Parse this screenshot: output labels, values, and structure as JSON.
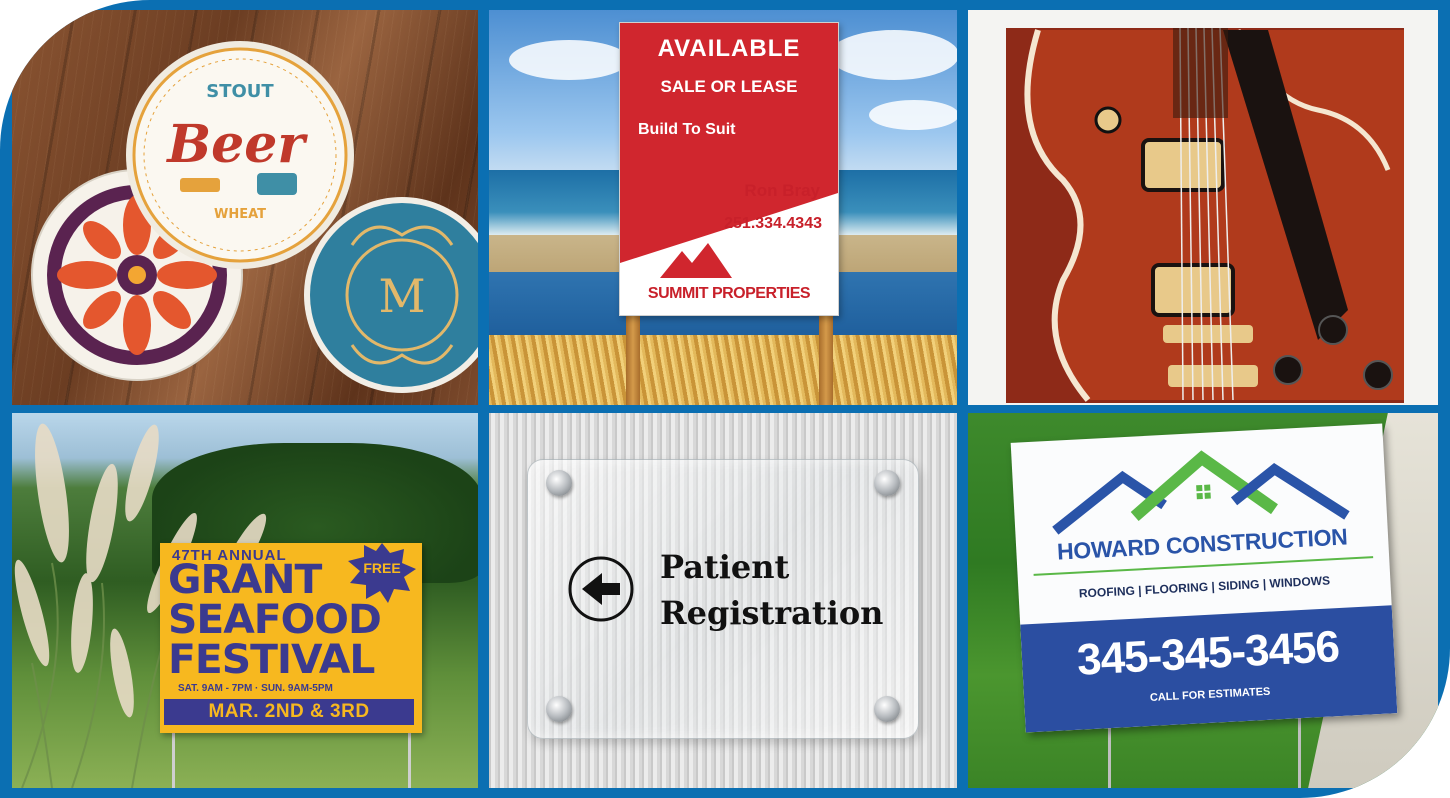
{
  "colors": {
    "frame": "#0b6fb2",
    "real_estate_red": "#d0262e",
    "festival_yellow": "#f7b81f",
    "festival_navy": "#3b3a8f",
    "construction_blue": "#2b4ea1",
    "construction_green": "#5ab847"
  },
  "tiles": {
    "coasters": {
      "beer_coaster": {
        "word_stout": "STOUT",
        "word_beer": "Beer",
        "word_wheat": "WHEAT"
      },
      "monogram_coaster": {
        "letter": "M"
      }
    },
    "real_estate_sign": {
      "line1": "AVAILABLE",
      "line2": "SALE OR LEASE",
      "line3": "Build To Suit",
      "agent": "Ron Bray",
      "phone": "251.334.4343",
      "company": "SUMMIT PROPERTIES"
    },
    "guitar_print": {},
    "festival_sign": {
      "annual": "47TH ANNUAL",
      "line1": "GRANT",
      "line2": "SEAFOOD",
      "line3": "FESTIVAL",
      "badge": "FREE",
      "hours": "SAT. 9AM - 7PM · SUN. 9AM-5PM",
      "dates": "MAR. 2ND & 3RD"
    },
    "wayfinding_sign": {
      "line1": "Patient",
      "line2": "Registration"
    },
    "construction_sign": {
      "company": "HOWARD CONSTRUCTION",
      "services": "ROOFING | FLOORING | SIDING | WINDOWS",
      "phone": "345-345-3456",
      "cta": "CALL FOR ESTIMATES"
    }
  }
}
